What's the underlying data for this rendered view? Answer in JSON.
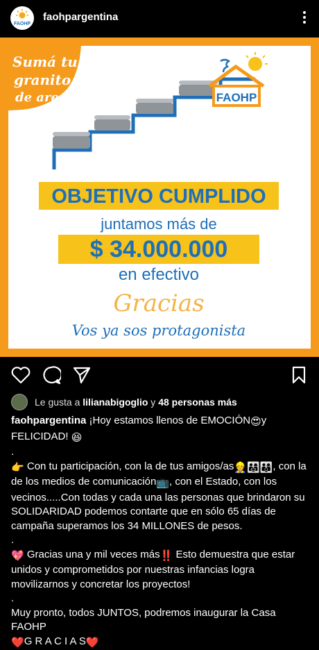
{
  "header": {
    "username": "faohpargentina",
    "logo_text": "FAOHP"
  },
  "post_image": {
    "badge_line1": "Sumá tu",
    "badge_line2": "granito",
    "badge_line3": "de arena",
    "house_label": "FAOHP",
    "headline": "OBJETIVO CUMPLIDO",
    "subline": "juntamos más de",
    "amount": "$ 34.000.000",
    "cash": "en efectivo",
    "thanks": "Gracias",
    "protagonist": "Vos ya sos protagonista"
  },
  "likes": {
    "prefix": "Le gusta a",
    "user": "lilianabigoglio",
    "connector": "y",
    "others": "48 personas más"
  },
  "caption": {
    "username": "faohpargentina",
    "line1": "¡Hoy estamos llenos de EMOCIÓN",
    "line1_end": "y FELICIDAD!",
    "dot1": ".",
    "para2a": "Con tu participación, con la de tus amigos/as",
    "para2b": ", con la de los medios de comunicación",
    "para2c": ", con el Estado, con los vecinos.....Con todas y cada una las personas que brindaron su SOLIDARIDAD podemos contarte que en sólo 65 días de campaña superamos los 34 MILLONES de pesos.",
    "dot2": ".",
    "para3a": "Gracias una y mil veces más",
    "para3b": " Esto demuestra que estar unidos y comprometidos por nuestras infancias logra movilizarnos y concretar los proyectos!",
    "dot3": ".",
    "para4": "Muy pronto, todos JUNTOS, podremos inaugurar la Casa FAOHP",
    "gracias": "G R A C I A S"
  },
  "colors": {
    "accent": "#f59a1b",
    "brand_blue": "#1e6fb8",
    "yellow": "#f7c21a"
  }
}
